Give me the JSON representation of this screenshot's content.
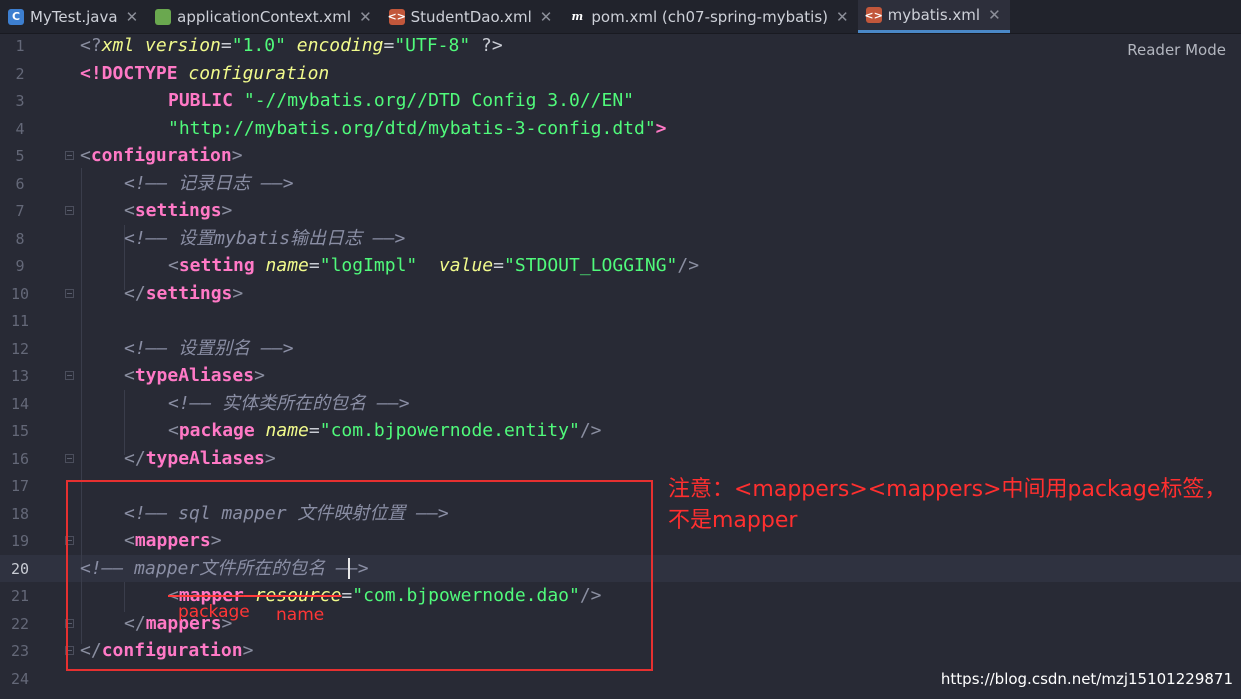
{
  "tabs": [
    {
      "label": "MyTest.java",
      "icon": "java-class-icon",
      "active": false
    },
    {
      "label": "applicationContext.xml",
      "icon": "spring-config-icon",
      "active": false
    },
    {
      "label": "StudentDao.xml",
      "icon": "xml-file-icon",
      "active": false
    },
    {
      "label": "pom.xml (ch07-spring-mybatis)",
      "icon": "maven-pom-icon",
      "active": false
    },
    {
      "label": "mybatis.xml",
      "icon": "xml-file-icon",
      "active": true
    }
  ],
  "close_glyph": "✕",
  "reader_mode": "Reader Mode",
  "current_line": 20,
  "line_numbers": [
    "1",
    "2",
    "3",
    "4",
    "5",
    "6",
    "7",
    "8",
    "9",
    "10",
    "11",
    "12",
    "13",
    "14",
    "15",
    "16",
    "17",
    "18",
    "19",
    "20",
    "21",
    "22",
    "23",
    "24"
  ],
  "code": {
    "l1": {
      "a": "<?",
      "b": "xml",
      "c": " version",
      "d": "=",
      "e": "\"1.0\"",
      "f": " encoding",
      "g": "=",
      "h": "\"UTF-8\"",
      "i": " ?>"
    },
    "l2": {
      "a": "<!DOCTYPE",
      "b": " configuration"
    },
    "l3": {
      "a": "PUBLIC",
      "b": " \"-//mybatis.org//DTD Config 3.0//EN\""
    },
    "l4": {
      "a": "\"http://mybatis.org/dtd/mybatis-3-config.dtd\"",
      "b": ">"
    },
    "l5": {
      "a": "<",
      "b": "configuration",
      "c": ">"
    },
    "l6": {
      "a": "<!—— 记录日志 ——>"
    },
    "l7": {
      "a": "<",
      "b": "settings",
      "c": ">"
    },
    "l8": {
      "a": "<!—— 设置mybatis输出日志 ——>"
    },
    "l9": {
      "a": "<",
      "b": "setting",
      "c": " name",
      "d": "=",
      "e": "\"logImpl\"",
      "f": "  value",
      "g": "=",
      "h": "\"STDOUT_LOGGING\"",
      "i": "/>"
    },
    "l10": {
      "a": "</",
      "b": "settings",
      "c": ">"
    },
    "l12": {
      "a": "<!—— 设置别名 ——>"
    },
    "l13": {
      "a": "<",
      "b": "typeAliases",
      "c": ">"
    },
    "l14": {
      "a": "<!—— 实体类所在的包名 ——>"
    },
    "l15": {
      "a": "<",
      "b": "package",
      "c": " name",
      "d": "=",
      "e": "\"com.bjpowernode.entity\"",
      "f": "/>"
    },
    "l16": {
      "a": "</",
      "b": "typeAliases",
      "c": ">"
    },
    "l18": {
      "a": "<!—— sql mapper 文件映射位置 ——>"
    },
    "l19": {
      "a": "<",
      "b": "mappers",
      "c": ">"
    },
    "l20": {
      "a": "<!—— mapper文件所在的包名 ——>"
    },
    "l21": {
      "a": "<",
      "b": "mapper",
      "c": " resource",
      "d": "=",
      "e": "\"com.bjpowernode.dao\"",
      "f": "/>"
    },
    "l22": {
      "a": "</",
      "b": "mappers",
      "c": ">"
    },
    "l23": {
      "a": "</",
      "b": "configuration",
      "c": ">"
    }
  },
  "annotation": {
    "note": "注意：<mappers><mappers>中间用package标签，不是mapper",
    "handwritten_package": "package",
    "handwritten_name": "name",
    "color": "#ff2f2f"
  },
  "watermark": "https://blog.csdn.net/mzj15101229871",
  "colors": {
    "background": "#282a35",
    "tag": "#ff79c6",
    "string": "#50fa7b",
    "attribute": "#f1fa8c",
    "comment": "#8a8ea4"
  }
}
